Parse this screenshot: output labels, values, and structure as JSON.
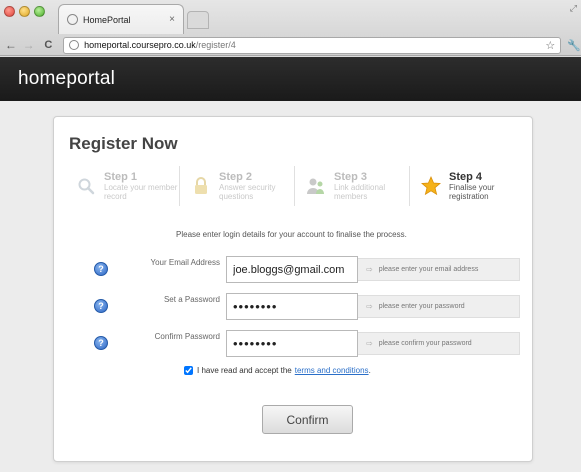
{
  "browser": {
    "tab_title": "HomePortal",
    "tab_close": "×",
    "url_host": "homeportal.coursepro.co.uk",
    "url_path": "/register/4"
  },
  "site": {
    "logo": "homeportal"
  },
  "card": {
    "title": "Register Now",
    "steps": [
      {
        "title": "Step 1",
        "desc": "Locate your member record",
        "icon": "search-icon",
        "active": false
      },
      {
        "title": "Step 2",
        "desc": "Answer security questions",
        "icon": "lock-icon",
        "active": false
      },
      {
        "title": "Step 3",
        "desc": "Link additional members",
        "icon": "users-icon",
        "active": false
      },
      {
        "title": "Step 4",
        "desc": "Finalise your registration",
        "icon": "star-icon",
        "active": true
      }
    ],
    "intro": "Please enter login details for your account to finalise the process.",
    "fields": {
      "email": {
        "label": "Your Email Address",
        "value": "joe.bloggs@gmail.com",
        "hint": "please enter your email address"
      },
      "password": {
        "label": "Set a Password",
        "value": "••••••••",
        "hint": "please enter your password"
      },
      "confirm": {
        "label": "Confirm Password",
        "value": "••••••••",
        "hint": "please confirm your password"
      }
    },
    "terms": {
      "text": "I have read and accept the",
      "link": "terms and conditions",
      "suffix": ".",
      "checked": true
    },
    "confirm_label": "Confirm"
  },
  "colors": {
    "accent_link": "#2a6fc9",
    "header_bg": "#1f1f1f",
    "help_icon": "#2b65c4",
    "active_star": "#f5b21a"
  }
}
